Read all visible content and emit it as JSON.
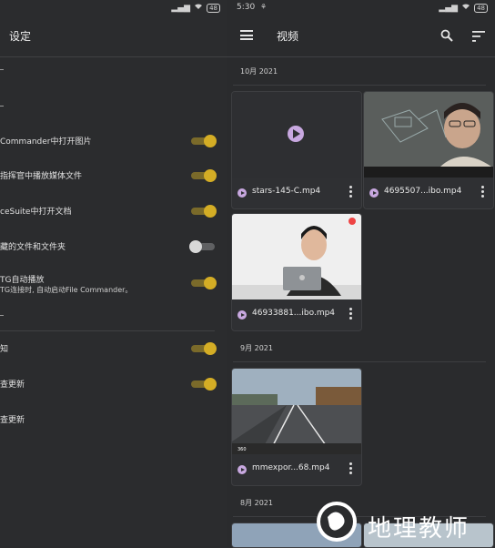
{
  "left": {
    "status": {
      "signal": "▂▄▆",
      "battery": "48"
    },
    "title": "设定",
    "settings": [
      {
        "label": "Commander中打开图片",
        "on": true
      },
      {
        "label": "指挥官中播放媒体文件",
        "on": true
      },
      {
        "label": "ceSuite中打开文档",
        "on": true
      },
      {
        "label": "藏的文件和文件夹",
        "on": false
      },
      {
        "label": "TG自动播放",
        "sub": "TG连接时, 自动启动File Commander。",
        "on": true
      },
      {
        "label": "知",
        "on": true
      },
      {
        "label": "查更新",
        "on": true
      },
      {
        "label": "查更新"
      }
    ]
  },
  "right": {
    "status": {
      "time": "5:30",
      "battery": "48"
    },
    "title": "视频",
    "sections": [
      {
        "date": "10月 2021"
      },
      {
        "date": "9月 2021"
      },
      {
        "date": "8月 2021"
      }
    ],
    "videos": [
      {
        "name": "stars-145-C.mp4"
      },
      {
        "name": "4695507...ibo.mp4"
      },
      {
        "name": "46933881...ibo.mp4"
      },
      {
        "name": "mmexpor...68.mp4"
      }
    ]
  },
  "watermark": {
    "text": "地理教师"
  },
  "colors": {
    "accent": "#d4ad25",
    "play": "#c8a8e0",
    "bg": "#2a2b2d"
  }
}
